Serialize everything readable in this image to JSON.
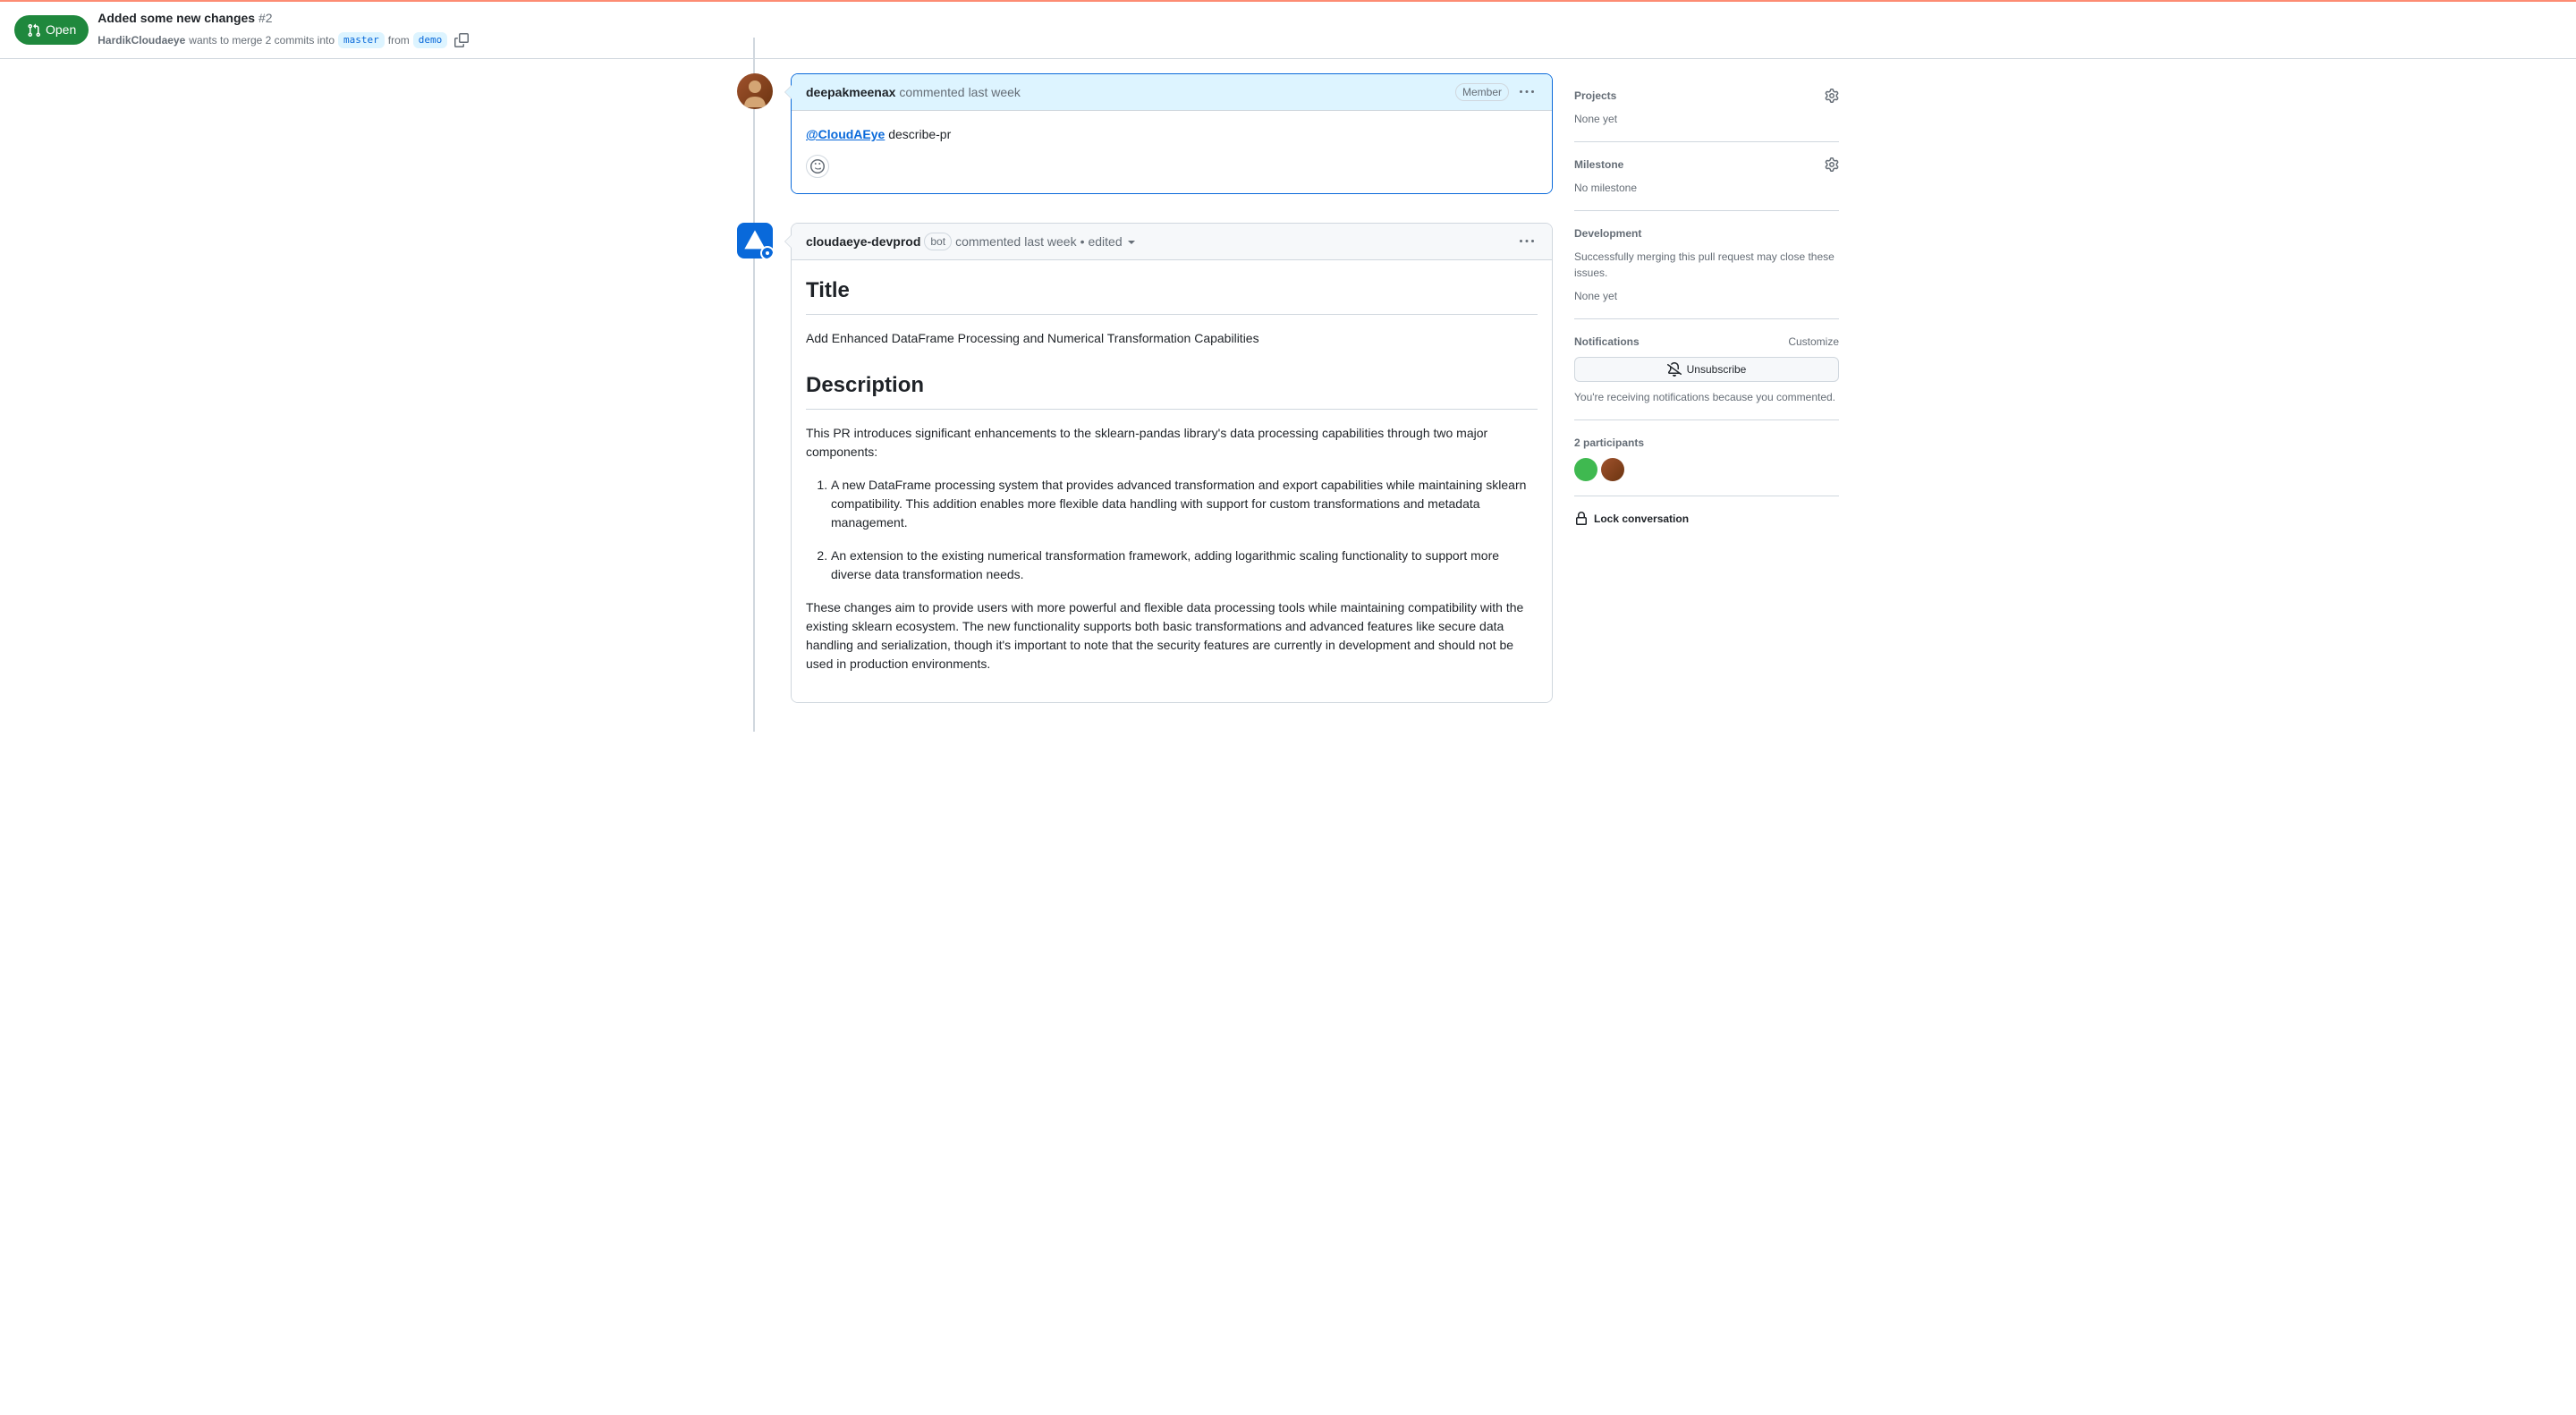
{
  "header": {
    "state": "Open",
    "title": "Added some new changes",
    "number": "#2",
    "author": "HardikCloudaeye",
    "meta_prefix": "wants to merge 2 commits into",
    "base_branch": "master",
    "from_text": "from",
    "head_branch": "demo"
  },
  "comments": [
    {
      "author": "deepakmeenax",
      "commented_text": "commented",
      "timestamp": "last week",
      "role_badge": "Member",
      "body_mention": "@CloudAEye",
      "body_text": " describe-pr"
    },
    {
      "author": "cloudaeye-devprod",
      "bot_label": "bot",
      "commented_text": "commented",
      "timestamp": "last week",
      "edited_bullet": "•",
      "edited_text": "edited",
      "body": {
        "h2_title": "Title",
        "title_text": "Add Enhanced DataFrame Processing and Numerical Transformation Capabilities",
        "h2_description": "Description",
        "desc_intro": "This PR introduces significant enhancements to the sklearn-pandas library's data processing capabilities through two major components:",
        "list_1": "A new DataFrame processing system that provides advanced transformation and export capabilities while maintaining sklearn compatibility. This addition enables more flexible data handling with support for custom transformations and metadata management.",
        "list_2": "An extension to the existing numerical transformation framework, adding logarithmic scaling functionality to support more diverse data transformation needs.",
        "desc_para": "These changes aim to provide users with more powerful and flexible data processing tools while maintaining compatibility with the existing sklearn ecosystem. The new functionality supports both basic transformations and advanced features like secure data handling and serialization, though it's important to note that the security features are currently in development and should not be used in production environments."
      }
    }
  ],
  "sidebar": {
    "projects": {
      "title": "Projects",
      "value": "None yet"
    },
    "milestone": {
      "title": "Milestone",
      "value": "No milestone"
    },
    "development": {
      "title": "Development",
      "desc": "Successfully merging this pull request may close these issues.",
      "value": "None yet"
    },
    "notifications": {
      "title": "Notifications",
      "customize": "Customize",
      "button": "Unsubscribe",
      "text": "You're receiving notifications because you commented."
    },
    "participants": {
      "title": "2 participants"
    },
    "lock": {
      "text": "Lock conversation"
    }
  }
}
